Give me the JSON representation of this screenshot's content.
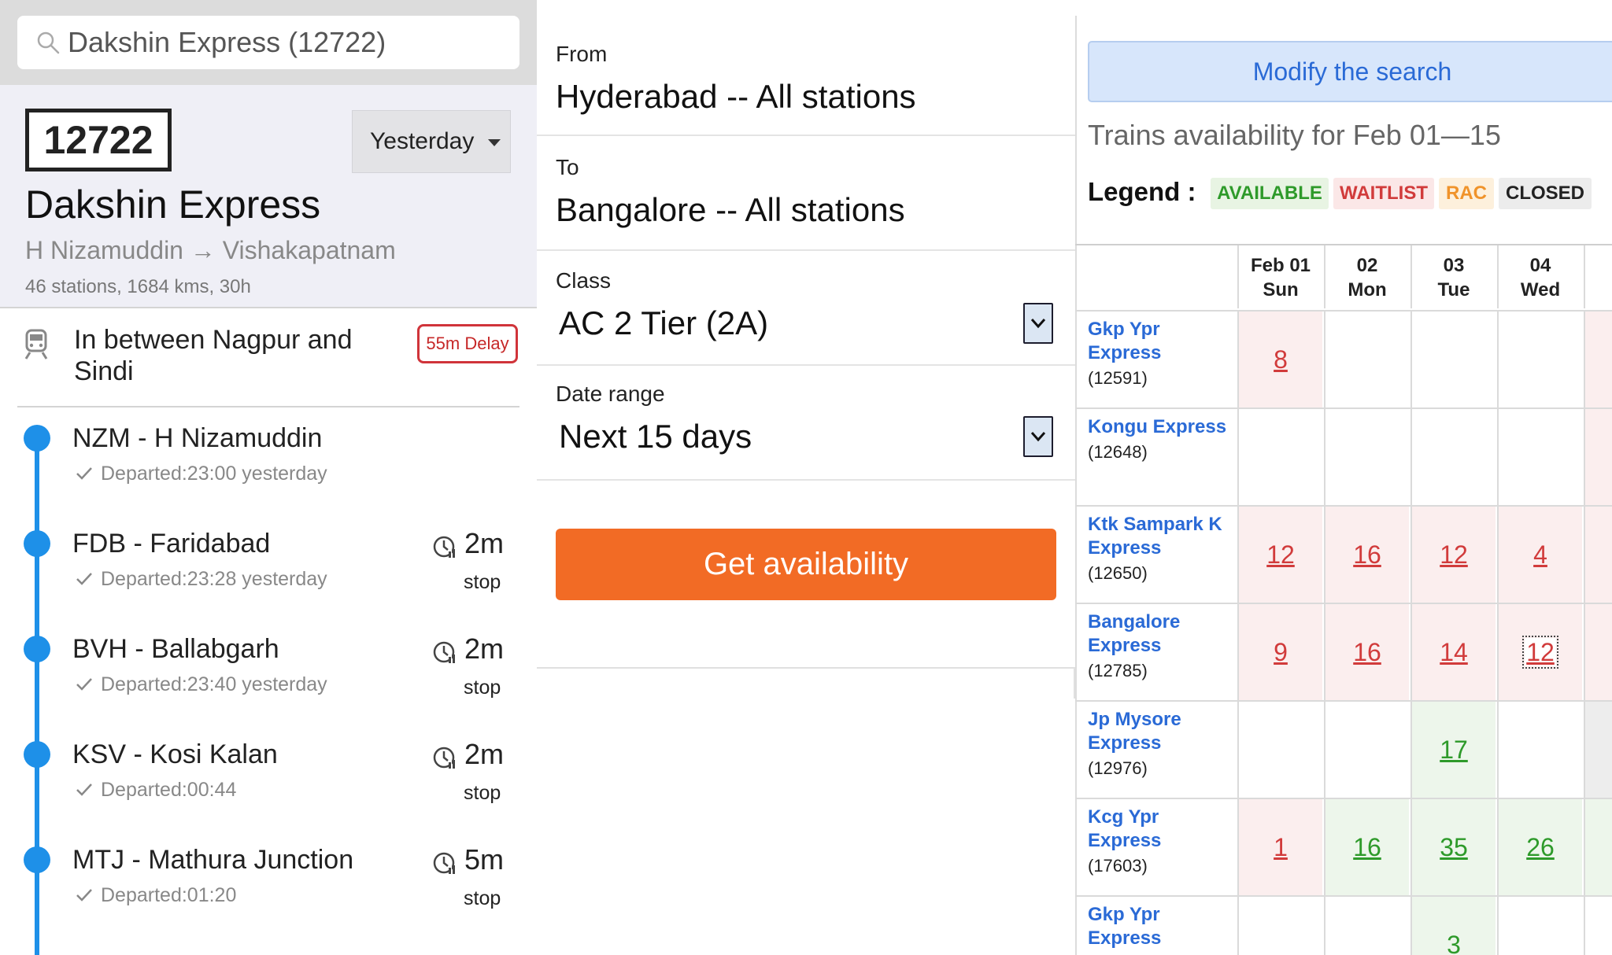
{
  "search": {
    "value": "Dakshin Express (12722)"
  },
  "train": {
    "number": "12722",
    "day_selected": "Yesterday",
    "name": "Dakshin Express",
    "route": "H Nizamuddin → Vishakapatnam",
    "meta": "46 stations, 1684 kms, 30h",
    "status": "In between Nagpur and Sindi",
    "delay": "55m Delay"
  },
  "stops": [
    {
      "name": "NZM - H Nizamuddin",
      "departed": "Departed:23:00 yesterday",
      "halt": "",
      "halt_unit": ""
    },
    {
      "name": "FDB - Faridabad",
      "departed": "Departed:23:28 yesterday",
      "halt": "2m",
      "halt_unit": "stop"
    },
    {
      "name": "BVH - Ballabgarh",
      "departed": "Departed:23:40 yesterday",
      "halt": "2m",
      "halt_unit": "stop"
    },
    {
      "name": "KSV - Kosi Kalan",
      "departed": "Departed:00:44",
      "halt": "2m",
      "halt_unit": "stop"
    },
    {
      "name": "MTJ - Mathura Junction",
      "departed": "Departed:01:20",
      "halt": "5m",
      "halt_unit": "stop"
    }
  ],
  "form": {
    "from_label": "From",
    "from_value": "Hyderabad -- All stations",
    "to_label": "To",
    "to_value": "Bangalore -- All stations",
    "class_label": "Class",
    "class_value": "AC 2 Tier (2A)",
    "date_label": "Date range",
    "date_value": "Next 15 days",
    "submit_label": "Get availability"
  },
  "availability": {
    "modify_label": "Modify the search",
    "title": "Trains availability for Feb 01—15",
    "legend_label": "Legend :",
    "legend": {
      "available": "AVAILABLE",
      "waitlist": "WAITLIST",
      "rac": "RAC",
      "closed": "CLOSED"
    },
    "colors": {
      "available": "#2e9a2a",
      "waitlist": "#d13b3b",
      "rac": "#f0932a",
      "link": "#2a6ad6",
      "button": "#f26b25"
    },
    "columns": [
      {
        "date": "Feb 01",
        "day": "Sun"
      },
      {
        "date": "02",
        "day": "Mon"
      },
      {
        "date": "03",
        "day": "Tue"
      },
      {
        "date": "04",
        "day": "Wed"
      },
      {
        "date": "",
        "day": ""
      }
    ],
    "rows": [
      {
        "name": "Gkp Ypr Express",
        "number": "(12591)",
        "cells": [
          {
            "v": "8",
            "s": "w"
          },
          {
            "v": "",
            "s": "e"
          },
          {
            "v": "",
            "s": "e"
          },
          {
            "v": "",
            "s": "e"
          },
          {
            "v": "",
            "s": "w"
          }
        ]
      },
      {
        "name": "Kongu Express",
        "number": "(12648)",
        "cells": [
          {
            "v": "",
            "s": "e"
          },
          {
            "v": "",
            "s": "e"
          },
          {
            "v": "",
            "s": "e"
          },
          {
            "v": "",
            "s": "e"
          },
          {
            "v": "",
            "s": "w"
          }
        ]
      },
      {
        "name": "Ktk Sampark K Express",
        "number": "(12650)",
        "cells": [
          {
            "v": "12",
            "s": "w"
          },
          {
            "v": "16",
            "s": "w"
          },
          {
            "v": "12",
            "s": "w"
          },
          {
            "v": "4",
            "s": "w"
          },
          {
            "v": "",
            "s": "w"
          }
        ]
      },
      {
        "name": "Bangalore Express",
        "number": "(12785)",
        "cells": [
          {
            "v": "9",
            "s": "w"
          },
          {
            "v": "16",
            "s": "w"
          },
          {
            "v": "14",
            "s": "w"
          },
          {
            "v": "12",
            "s": "w"
          },
          {
            "v": "",
            "s": "w"
          }
        ]
      },
      {
        "name": "Jp Mysore Express",
        "number": "(12976)",
        "cells": [
          {
            "v": "",
            "s": "e"
          },
          {
            "v": "",
            "s": "e"
          },
          {
            "v": "17",
            "s": "a"
          },
          {
            "v": "",
            "s": "e"
          },
          {
            "v": "",
            "s": "x"
          }
        ]
      },
      {
        "name": "Kcg Ypr Express",
        "number": "(17603)",
        "cells": [
          {
            "v": "1",
            "s": "w"
          },
          {
            "v": "16",
            "s": "a"
          },
          {
            "v": "35",
            "s": "a"
          },
          {
            "v": "26",
            "s": "a"
          },
          {
            "v": "",
            "s": "a"
          }
        ]
      },
      {
        "name": "Gkp Ypr Express",
        "number": "",
        "cells": [
          {
            "v": "",
            "s": "e"
          },
          {
            "v": "",
            "s": "e"
          },
          {
            "v": "3",
            "s": "a"
          },
          {
            "v": "",
            "s": "e"
          },
          {
            "v": "",
            "s": "e"
          }
        ]
      }
    ]
  }
}
